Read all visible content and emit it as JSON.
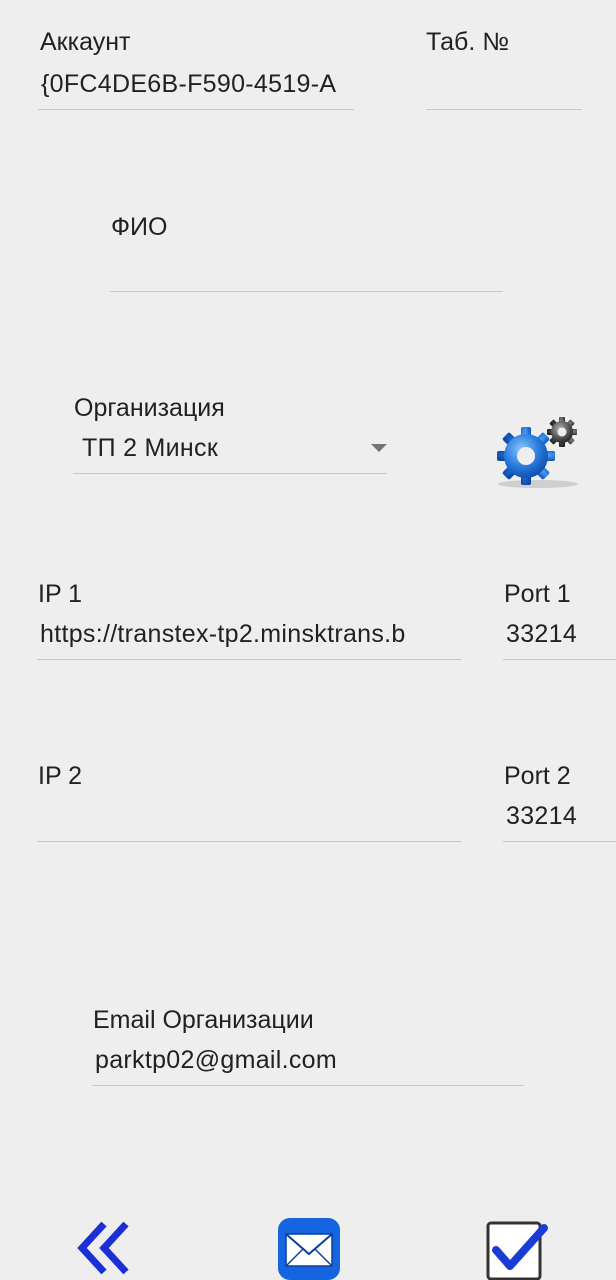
{
  "account": {
    "label": "Аккаунт",
    "value": "{0FC4DE6B-F590-4519-A"
  },
  "tab_number": {
    "label": "Таб. №",
    "value": ""
  },
  "fio": {
    "label": "ФИО",
    "value": ""
  },
  "organization": {
    "label": "Организация",
    "selected": "ТП 2 Минск"
  },
  "ip1": {
    "label": "IP 1",
    "value": "https://transtex-tp2.minsktrans.b"
  },
  "port1": {
    "label": "Port 1",
    "value": "33214"
  },
  "ip2": {
    "label": "IP 2",
    "value": ""
  },
  "port2": {
    "label": "Port 2",
    "value": "33214"
  },
  "email": {
    "label": "Email Организации",
    "value": "parktp02@gmail.com"
  },
  "icons": {
    "settings": "gears-icon",
    "back": "double-chevron-left-icon",
    "mail": "envelope-icon",
    "confirm": "checkbox-checked-icon"
  },
  "colors": {
    "background": "#eeeeee",
    "text": "#212121",
    "underline": "#c8c8c8",
    "accent_blue": "#1a2fd6",
    "mail_blue": "#1565e0"
  }
}
